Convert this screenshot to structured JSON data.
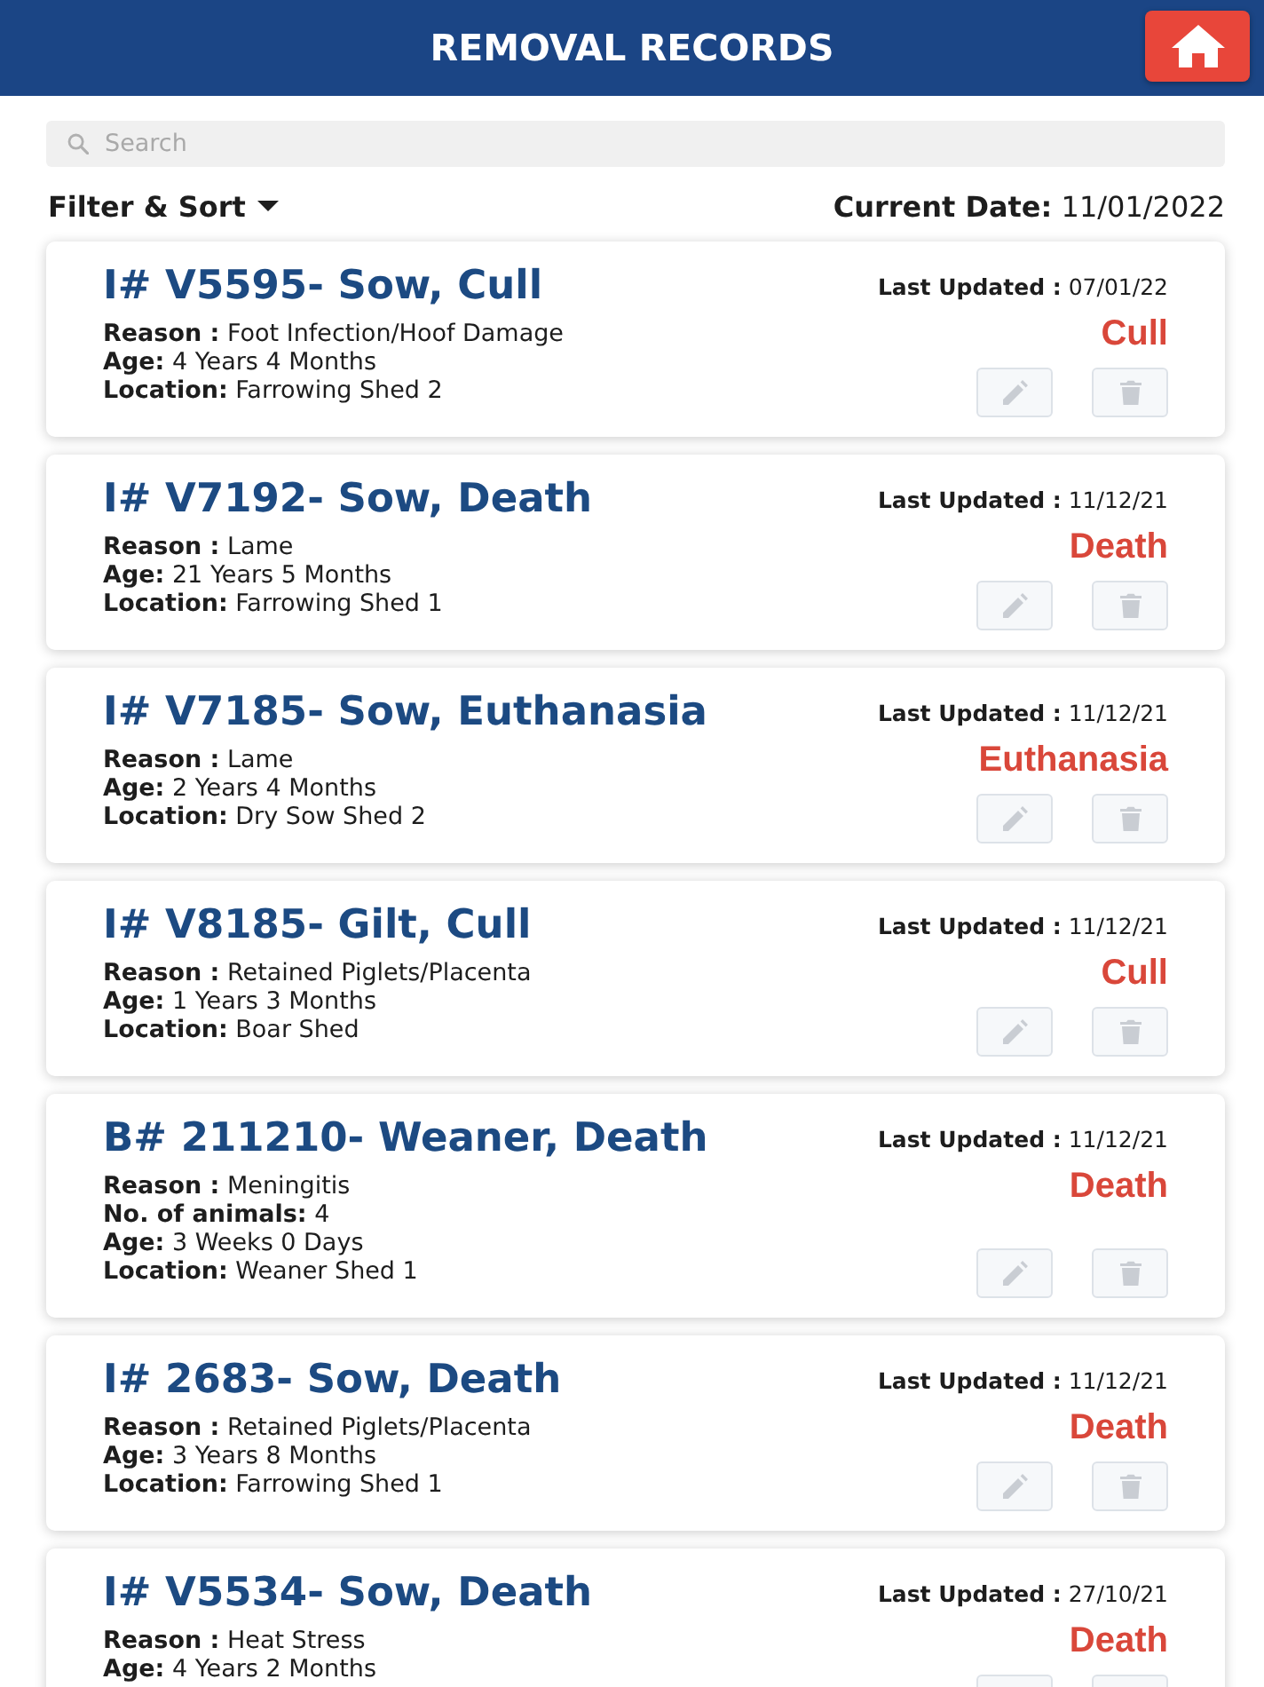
{
  "header": {
    "title": "REMOVAL RECORDS"
  },
  "search": {
    "placeholder": "Search"
  },
  "filter": {
    "label": "Filter & Sort"
  },
  "current_date": {
    "label": "Current Date:",
    "value": "11/01/2022"
  },
  "records": [
    {
      "title": "I# V5595- Sow, Cull",
      "details": [
        {
          "label": "Reason :",
          "value": "Foot Infection/Hoof Damage"
        },
        {
          "label": "Age:",
          "value": "4 Years 4 Months"
        },
        {
          "label": "Location:",
          "value": "Farrowing Shed 2"
        }
      ],
      "last_updated": {
        "label": "Last Updated :",
        "value": "07/01/22"
      },
      "status": "Cull"
    },
    {
      "title": "I# V7192- Sow, Death",
      "details": [
        {
          "label": "Reason :",
          "value": "Lame"
        },
        {
          "label": "Age:",
          "value": "21 Years 5 Months"
        },
        {
          "label": "Location:",
          "value": "Farrowing Shed 1"
        }
      ],
      "last_updated": {
        "label": "Last Updated :",
        "value": "11/12/21"
      },
      "status": "Death"
    },
    {
      "title": "I# V7185- Sow, Euthanasia",
      "details": [
        {
          "label": "Reason :",
          "value": "Lame"
        },
        {
          "label": "Age:",
          "value": "2 Years 4 Months"
        },
        {
          "label": "Location:",
          "value": "Dry Sow Shed 2"
        }
      ],
      "last_updated": {
        "label": "Last Updated :",
        "value": "11/12/21"
      },
      "status": "Euthanasia"
    },
    {
      "title": "I# V8185- Gilt, Cull",
      "details": [
        {
          "label": "Reason :",
          "value": "Retained Piglets/Placenta"
        },
        {
          "label": "Age:",
          "value": "1 Years 3 Months"
        },
        {
          "label": "Location:",
          "value": "Boar Shed"
        }
      ],
      "last_updated": {
        "label": "Last Updated :",
        "value": "11/12/21"
      },
      "status": "Cull"
    },
    {
      "title": "B# 211210- Weaner, Death",
      "details": [
        {
          "label": "Reason :",
          "value": "Meningitis"
        },
        {
          "label": "No. of animals:",
          "value": "4"
        },
        {
          "label": "Age:",
          "value": "3 Weeks 0 Days"
        },
        {
          "label": "Location:",
          "value": "Weaner Shed 1"
        }
      ],
      "last_updated": {
        "label": "Last Updated :",
        "value": "11/12/21"
      },
      "status": "Death"
    },
    {
      "title": "I# 2683- Sow, Death",
      "details": [
        {
          "label": "Reason :",
          "value": "Retained Piglets/Placenta"
        },
        {
          "label": "Age:",
          "value": "3 Years 8 Months"
        },
        {
          "label": "Location:",
          "value": "Farrowing Shed 1"
        }
      ],
      "last_updated": {
        "label": "Last Updated :",
        "value": "11/12/21"
      },
      "status": "Death"
    },
    {
      "title": "I# V5534- Sow, Death",
      "details": [
        {
          "label": "Reason :",
          "value": "Heat Stress"
        },
        {
          "label": "Age:",
          "value": "4 Years 2 Months"
        }
      ],
      "last_updated": {
        "label": "Last Updated :",
        "value": "27/10/21"
      },
      "status": "Death"
    }
  ]
}
